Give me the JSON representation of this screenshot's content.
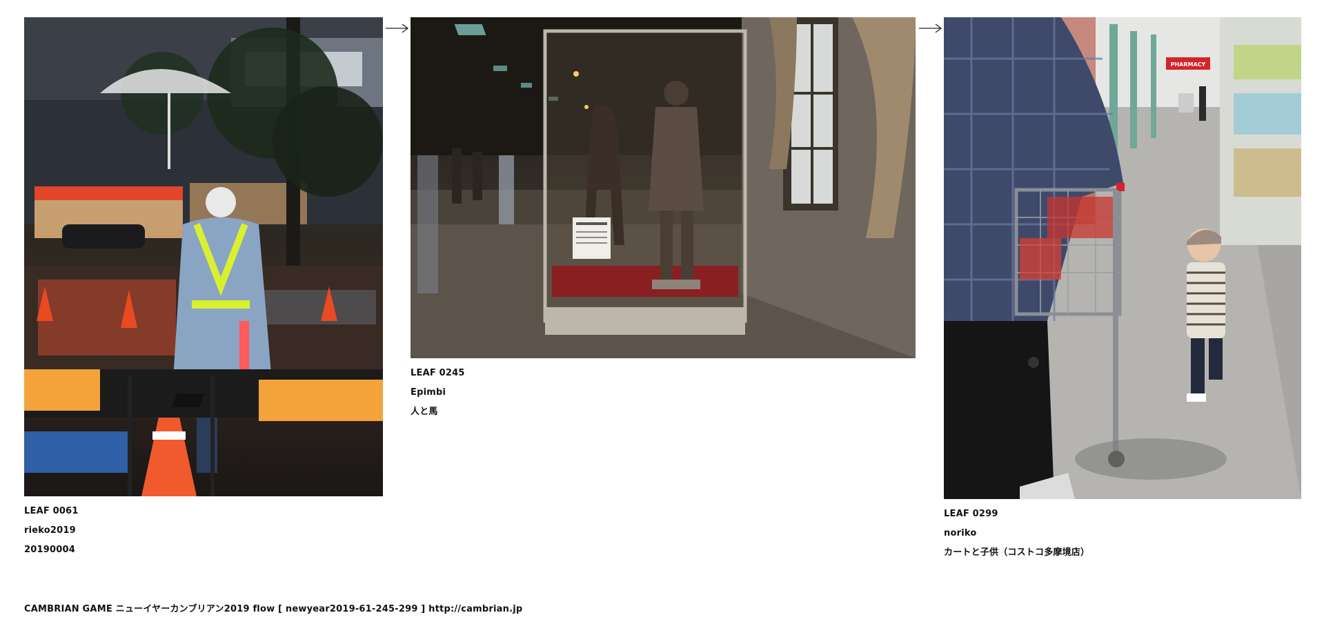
{
  "leaves": [
    {
      "id": "LEAF 0061",
      "author": "rieko2019",
      "title": "20190004",
      "photo_icon": "rainy-night-street-worker-photo"
    },
    {
      "id": "LEAF 0245",
      "author": "Epimbi",
      "title": "人と馬",
      "photo_icon": "museum-statue-horse-photo"
    },
    {
      "id": "LEAF 0299",
      "author": "noriko",
      "title": "カートと子供（コストコ多摩境店）",
      "photo_icon": "costco-cart-child-photo"
    }
  ],
  "arrows": [
    "arrow-right-icon",
    "arrow-right-icon"
  ],
  "footer": {
    "text": "CAMBRIAN GAME  ニューイヤーカンブリアン2019  flow [ newyear2019-61-245-299 ]    http://cambrian.jp"
  },
  "store_sign": "PHARMACY"
}
